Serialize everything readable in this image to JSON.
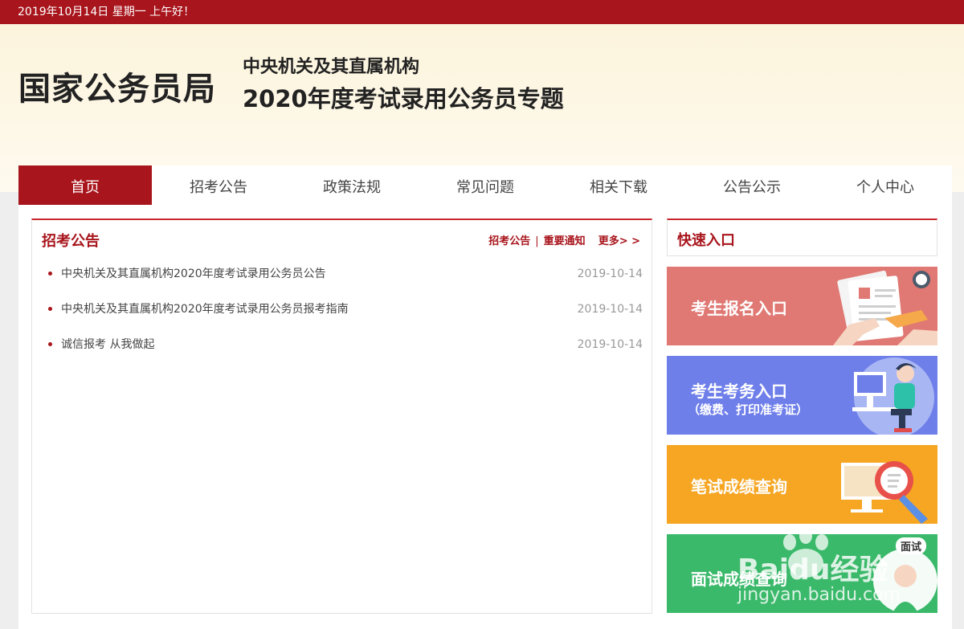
{
  "topbar": {
    "greeting": "2019年10月14日  星期一  上午好！"
  },
  "header": {
    "brand": "国家公务员局",
    "subtitle_line1": "中央机关及其直属机构",
    "subtitle_line2": "2020年度考试录用公务员专题"
  },
  "nav": {
    "items": [
      {
        "label": "首页",
        "active": true
      },
      {
        "label": "招考公告"
      },
      {
        "label": "政策法规"
      },
      {
        "label": "常见问题"
      },
      {
        "label": "相关下载"
      },
      {
        "label": "公告公示"
      },
      {
        "label": "个人中心"
      }
    ]
  },
  "notice": {
    "title": "招考公告",
    "link_announce": "招考公告",
    "separator": "|",
    "link_important": "重要通知",
    "link_more": "更多> >",
    "items": [
      {
        "title": "中央机关及其直属机构2020年度考试录用公务员公告",
        "date": "2019-10-14"
      },
      {
        "title": "中央机关及其直属机构2020年度考试录用公务员报考指南",
        "date": "2019-10-14"
      },
      {
        "title": "诚信报考  从我做起",
        "date": "2019-10-14"
      }
    ]
  },
  "quick": {
    "title": "快速入口",
    "cards": [
      {
        "label": "考生报名入口",
        "color": "#e07873"
      },
      {
        "label": "考生考务入口",
        "sub": "（缴费、打印准考证）",
        "color": "#6f7fea"
      },
      {
        "label": "笔试成绩查询",
        "color": "#f6a623"
      },
      {
        "label": "面试成绩查询",
        "color": "#3ab96a",
        "badge": "面试"
      }
    ]
  },
  "watermark": {
    "brand": "Baidu经验",
    "url": "jingyan.baidu.com"
  },
  "colors": {
    "primary": "#a8151c",
    "accent_line": "#c8262c"
  }
}
